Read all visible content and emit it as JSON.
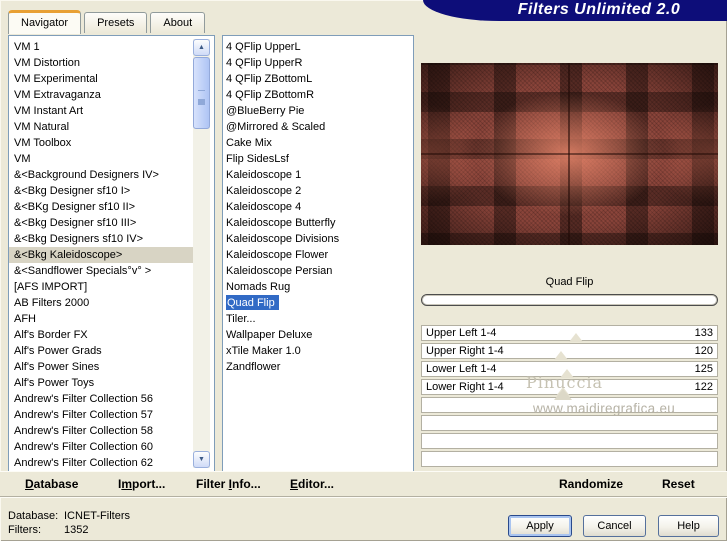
{
  "window": {
    "title": "Filters Unlimited 2.0"
  },
  "tabs": [
    {
      "label": "Navigator",
      "active": true
    },
    {
      "label": "Presets",
      "active": false
    },
    {
      "label": "About",
      "active": false
    }
  ],
  "category_list": {
    "selected": "&<Bkg Kaleidoscope>",
    "items": [
      "VM 1",
      "VM Distortion",
      "VM Experimental",
      "VM Extravaganza",
      "VM Instant Art",
      "VM Natural",
      "VM Toolbox",
      "VM",
      "&<Background Designers IV>",
      "&<Bkg Designer sf10 I>",
      "&<BKg Designer sf10 II>",
      "&<Bkg Designer sf10 III>",
      "&<Bkg Designers sf10 IV>",
      "&<Bkg Kaleidoscope>",
      "&<Sandflower Specials°v° >",
      "[AFS IMPORT]",
      "AB Filters 2000",
      "AFH",
      "Alf's Border FX",
      "Alf's Power Grads",
      "Alf's Power Sines",
      "Alf's Power Toys",
      "Andrew's Filter Collection 56",
      "Andrew's Filter Collection 57",
      "Andrew's Filter Collection 58",
      "Andrew's Filter Collection 60",
      "Andrew's Filter Collection 62"
    ]
  },
  "filter_list": {
    "selected": "Quad Flip",
    "items": [
      "4 QFlip UpperL",
      "4 QFlip UpperR",
      "4 QFlip ZBottomL",
      "4 QFlip ZBottomR",
      "@BlueBerry Pie",
      "@Mirrored & Scaled",
      "Cake Mix",
      "Flip SidesLsf",
      "Kaleidoscope 1",
      "Kaleidoscope 2",
      "Kaleidoscope 4",
      "Kaleidoscope Butterfly",
      "Kaleidoscope Divisions",
      "Kaleidoscope Flower",
      "Kaleidoscope Persian",
      "Nomads Rug",
      "Quad Flip",
      "Tiler...",
      "Wallpaper Deluxe",
      "xTile Maker 1.0",
      "Zandflower"
    ]
  },
  "preview": {
    "filter_name": "Quad Flip"
  },
  "sliders": {
    "items": [
      {
        "label": "Upper Left 1-4",
        "value": 133
      },
      {
        "label": "Upper Right 1-4",
        "value": 120
      },
      {
        "label": "Lower Left 1-4",
        "value": 125
      },
      {
        "label": "Lower Right 1-4",
        "value": 122
      }
    ],
    "empty_rows": 4
  },
  "watermark": {
    "name": "Pinuccia",
    "url": "www.maidiregrafica.eu"
  },
  "toolbar": {
    "commands": [
      {
        "pre": "",
        "key": "D",
        "post": "atabase"
      },
      {
        "pre": "I",
        "key": "m",
        "post": "port..."
      },
      {
        "pre": "Filter ",
        "key": "I",
        "post": "nfo..."
      },
      {
        "pre": "",
        "key": "E",
        "post": "ditor..."
      }
    ],
    "randomize": "Randomize",
    "reset": "Reset"
  },
  "status": {
    "database_label": "Database:",
    "database_value": "ICNET-Filters",
    "filters_label": "Filters:",
    "filters_value": "1352"
  },
  "buttons": {
    "apply": "Apply",
    "cancel": "Cancel",
    "help": "Help"
  },
  "colors": {
    "background": "#ece9d8",
    "banner": "#0d0d79",
    "selection": "#316ac5",
    "inactive_selection": "#d8d4c4",
    "tab_accent": "#e8a033"
  }
}
